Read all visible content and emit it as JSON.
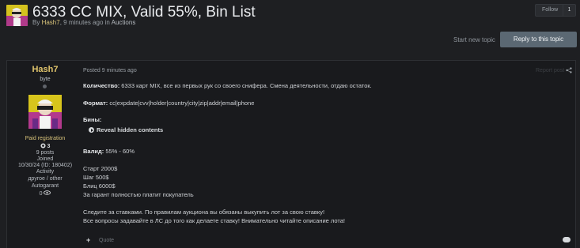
{
  "topic": {
    "title": "6333 CC MIX, Valid 55%, Bin List",
    "by_prefix": "By",
    "author": "Hash7",
    "time_forum_sep": ", 9 minutes ago in",
    "forum": "Auctions"
  },
  "follow": {
    "label": "Follow",
    "count": "1"
  },
  "actions": {
    "start_new_topic": "Start new topic",
    "reply": "Reply to this topic"
  },
  "post": {
    "meta": "Posted 9 minutes ago",
    "report": "Report post",
    "author": {
      "name": "Hash7",
      "title": "byte",
      "group": "Paid registration",
      "reputation": "3",
      "posts": "9 posts",
      "joined_label": "Joined",
      "joined_value": "10/30/24 (ID: 180402)",
      "activity_label": "Activity",
      "activity_value": "другое / other",
      "autogarant_label": "Autogarant",
      "autogarant_value": "0"
    },
    "body": {
      "qty_label": "Количество:",
      "qty_text": " 6333 карт MIX, все из первых рук со своего снифера. Смена деятельности, отдаю остаток.",
      "format_label": "Формат:",
      "format_text": " cc|expdate|cvv|holder|country|city|zip|addr|email|phone",
      "bins_label": "Бины:",
      "reveal": "Reveal hidden contents",
      "valid_label": "Валид:",
      "valid_text": " 55% - 60%",
      "start": "Старт 2000$",
      "step": "Шаг 500$",
      "blitz": "Блиц 6000$",
      "guarantee": "За гарант полностью платит покупатель",
      "follow_bids": "Следите за ставками. По правилам аукциона вы обязаны выкупить лот за свою ставку!",
      "questions": "Все вопросы задавайте в ЛС до того как делаете ставку! Внимательно читайте описание лота!"
    },
    "footer": {
      "quote": "Quote"
    }
  },
  "icons": [
    "share-icon",
    "plus-icon",
    "react-icon",
    "reveal-icon",
    "reputation-icon",
    "eye-icon",
    "online-status-dot"
  ]
}
